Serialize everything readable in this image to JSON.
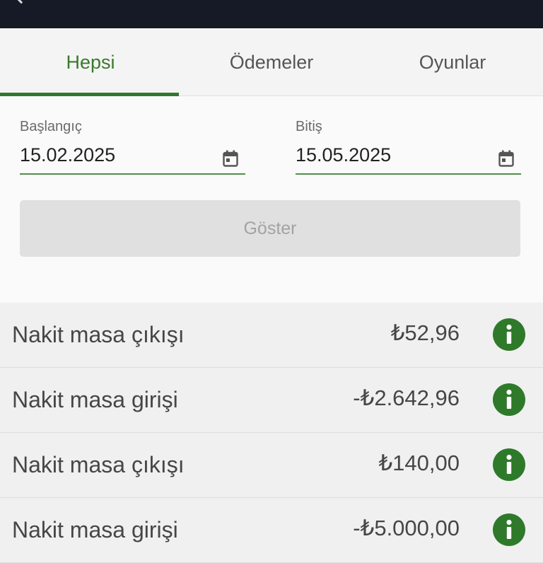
{
  "tabs": [
    {
      "label": "Hepsi",
      "active": true
    },
    {
      "label": "Ödemeler",
      "active": false
    },
    {
      "label": "Oyunlar",
      "active": false
    }
  ],
  "filters": {
    "start": {
      "label": "Başlangıç",
      "value": "15.02.2025",
      "icon": "calendar-icon"
    },
    "end": {
      "label": "Bitiş",
      "value": "15.05.2025",
      "icon": "calendar-icon"
    },
    "show_button": "Göster"
  },
  "transactions": [
    {
      "title": "Nakit masa çıkışı",
      "amount": "₺52,96",
      "icon": "info-icon"
    },
    {
      "title": "Nakit masa girişi",
      "amount": "-₺2.642,96",
      "icon": "info-icon"
    },
    {
      "title": "Nakit masa çıkışı",
      "amount": "₺140,00",
      "icon": "info-icon"
    },
    {
      "title": "Nakit masa girişi",
      "amount": "-₺5.000,00",
      "icon": "info-icon"
    }
  ],
  "colors": {
    "accent": "#2e7a2a",
    "topbar": "#161a26",
    "tab_active_text": "#3a7a2c"
  }
}
